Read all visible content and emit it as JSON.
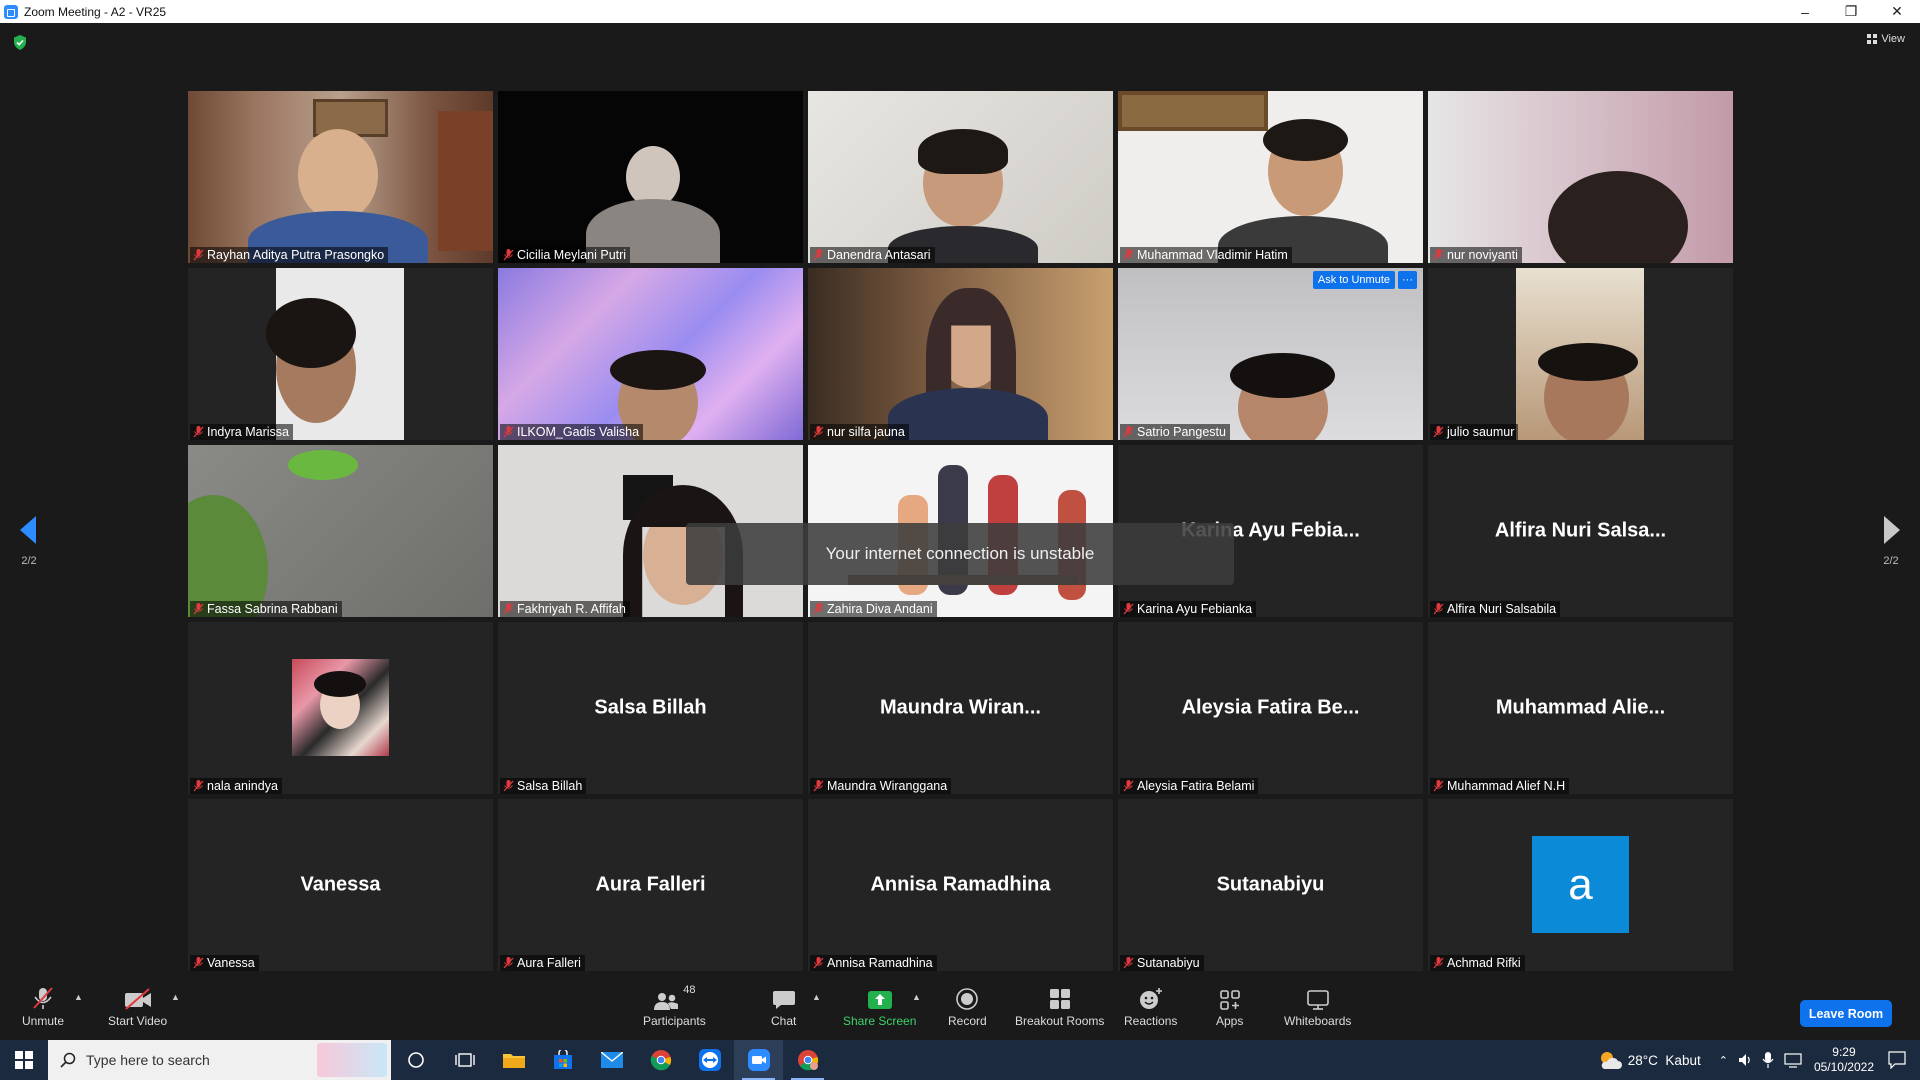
{
  "window": {
    "title": "Zoom Meeting - A2 - VR25",
    "view_label": "View"
  },
  "participants": [
    {
      "name": "Rayhan Aditya Putra Prasongko",
      "video": true
    },
    {
      "name": "Cicilia Meylani Putri",
      "video": true
    },
    {
      "name": "Danendra Antasari",
      "video": true
    },
    {
      "name": "Muhammad Vladimir Hatim",
      "video": true
    },
    {
      "name": "nur noviyanti",
      "video": true
    },
    {
      "name": "Indyra Marissa",
      "video": true
    },
    {
      "name": "ILKOM_Gadis Valisha",
      "video": true
    },
    {
      "name": "nur silfa jauna",
      "video": true
    },
    {
      "name": "Satrio Pangestu",
      "video": true
    },
    {
      "name": "julio saumur",
      "video": true
    },
    {
      "name": "Fassa Sabrina Rabbani",
      "video": true
    },
    {
      "name": "Fakhriyah R. Affifah",
      "video": true
    },
    {
      "name": "Zahira Diva Andani",
      "video": true
    },
    {
      "name": "Karina Ayu Febianka",
      "display": "Karina Ayu Febia...",
      "video": false
    },
    {
      "name": "Alfira Nuri Salsabila",
      "display": "Alfira Nuri Salsa...",
      "video": false
    },
    {
      "name": "nala anindya",
      "video": false
    },
    {
      "name": "Salsa Billah",
      "display": "Salsa Billah",
      "video": false
    },
    {
      "name": "Maundra Wiranggana",
      "display": "Maundra Wiran...",
      "video": false
    },
    {
      "name": "Aleysia Fatira Belami",
      "display": "Aleysia Fatira Be...",
      "video": false
    },
    {
      "name": "Muhammad Alief N.H",
      "display": "Muhammad Alie...",
      "video": false
    },
    {
      "name": "Vanessa",
      "display": "Vanessa",
      "video": false
    },
    {
      "name": "Aura Falleri",
      "display": "Aura Falleri",
      "video": false
    },
    {
      "name": "Annisa Ramadhina",
      "display": "Annisa Ramadhina",
      "video": false
    },
    {
      "name": "Sutanabiyu",
      "display": "Sutanabiyu",
      "video": false
    },
    {
      "name": "Achmad Rifki",
      "avatar_letter": "a",
      "video": false
    }
  ],
  "ask_to_unmute": "Ask to Unmute",
  "ask_more": "···",
  "toast": "Your internet connection is unstable",
  "pager": {
    "left": "2/2",
    "right": "2/2"
  },
  "toolbar": {
    "unmute": "Unmute",
    "start_video": "Start Video",
    "participants": "Participants",
    "participants_count": "48",
    "chat": "Chat",
    "share_screen": "Share Screen",
    "record": "Record",
    "breakout_rooms": "Breakout Rooms",
    "reactions": "Reactions",
    "apps": "Apps",
    "whiteboards": "Whiteboards",
    "leave": "Leave Room"
  },
  "taskbar": {
    "search_placeholder": "Type here to search",
    "weather": "28°C  Kabut",
    "time": "9:29",
    "date": "05/10/2022"
  }
}
